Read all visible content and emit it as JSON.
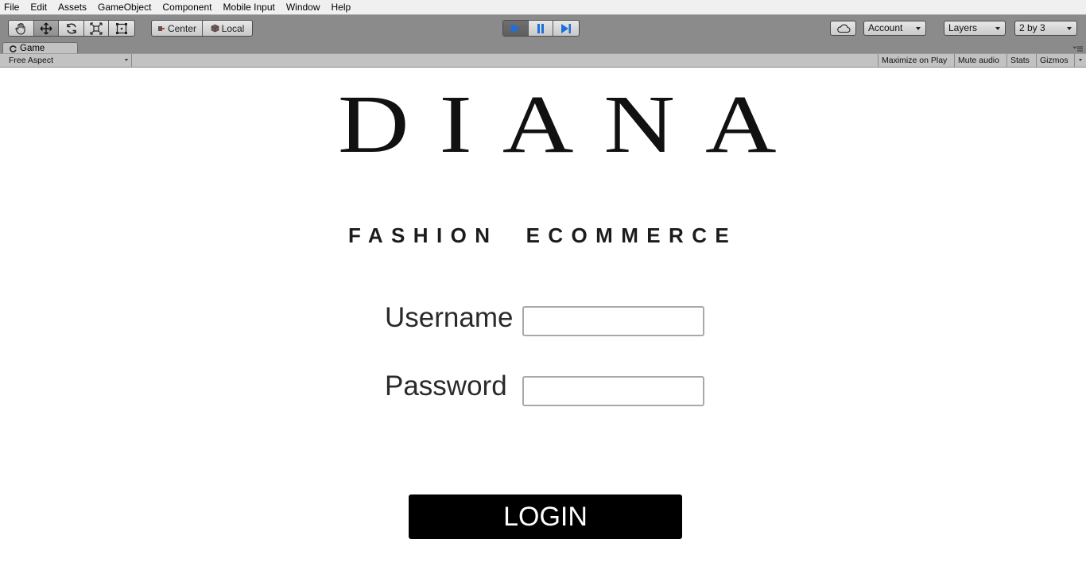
{
  "menu": {
    "items": [
      "File",
      "Edit",
      "Assets",
      "GameObject",
      "Component",
      "Mobile Input",
      "Window",
      "Help"
    ]
  },
  "toolbar": {
    "transform_tools": [
      {
        "icon": "hand-icon",
        "active": false
      },
      {
        "icon": "move-icon",
        "active": true
      },
      {
        "icon": "rotate-icon",
        "active": false
      },
      {
        "icon": "scale-icon",
        "active": false
      },
      {
        "icon": "rect-tool-icon",
        "active": false
      }
    ],
    "pivot_label": "Center",
    "space_label": "Local",
    "play_state": "playing",
    "account_label": "Account",
    "layers_label": "Layers",
    "layout_label": "2 by 3"
  },
  "tabs": {
    "game_label": "Game"
  },
  "game_bar": {
    "aspect_label": "Free Aspect",
    "maximize_label": "Maximize on Play",
    "mute_label": "Mute audio",
    "stats_label": "Stats",
    "gizmos_label": "Gizmos"
  },
  "login_screen": {
    "brand_title": "DIANA",
    "brand_subtitle": "FASHION  ECOMMERCE",
    "username_label": "Username",
    "username_value": "",
    "password_label": "Password",
    "password_value": "",
    "login_label": "LOGIN"
  },
  "colors": {
    "toolbar_bg": "#8b8b8b",
    "play_active": "#1e6fd9",
    "login_bg": "#000000",
    "login_text": "#ffffff"
  }
}
